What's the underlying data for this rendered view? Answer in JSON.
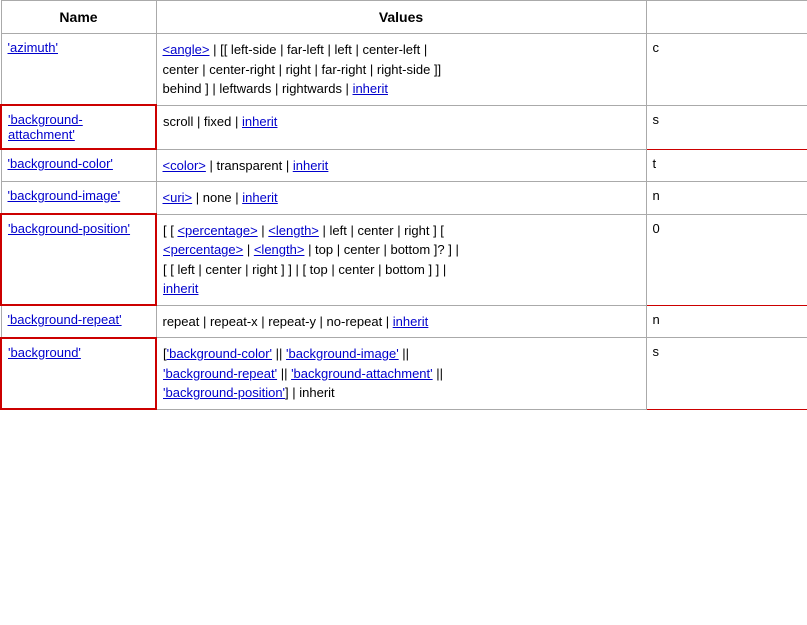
{
  "table": {
    "headers": [
      "Name",
      "Values",
      ""
    ],
    "rows": [
      {
        "id": "azimuth",
        "name_link": "'azimuth'",
        "values_html": true,
        "values": "<angle> | [[ left-side | far-left | left | center-left | center | center-right | right | far-right | right-side ]] behind ] | leftwards | rightwards | inherit",
        "extra": "c",
        "highlight_name": false
      },
      {
        "id": "background-attachment",
        "name_link": "'background-attachment'",
        "values": "scroll | fixed | inherit",
        "extra": "s",
        "highlight_name": true
      },
      {
        "id": "background-color",
        "name_link": "'background-color'",
        "values": "<color> | transparent | inherit",
        "extra": "t",
        "highlight_name": false
      },
      {
        "id": "background-image",
        "name_link": "'background-image'",
        "values": "<uri> | none | inherit",
        "extra": "n",
        "highlight_name": false
      },
      {
        "id": "background-position",
        "name_link": "'background-position'",
        "values": "[ [ <percentage> | <length> | left | center | right ] [ <percentage> | <length> | top | center | bottom ]? ] | [ [ left | center | right ] ] [ top | center | bottom ] ] | inherit",
        "extra": "0",
        "highlight_name": true
      },
      {
        "id": "background-repeat",
        "name_link": "'background-repeat'",
        "values": "repeat | repeat-x | repeat-y | no-repeat | inherit",
        "extra": "n",
        "highlight_name": false
      },
      {
        "id": "background",
        "name_link": "'background'",
        "values": "['background-color' || 'background-image' || 'background-repeat' || 'background-attachment' || 'background-position'] | inherit",
        "extra": "s",
        "highlight_name": true
      }
    ]
  }
}
